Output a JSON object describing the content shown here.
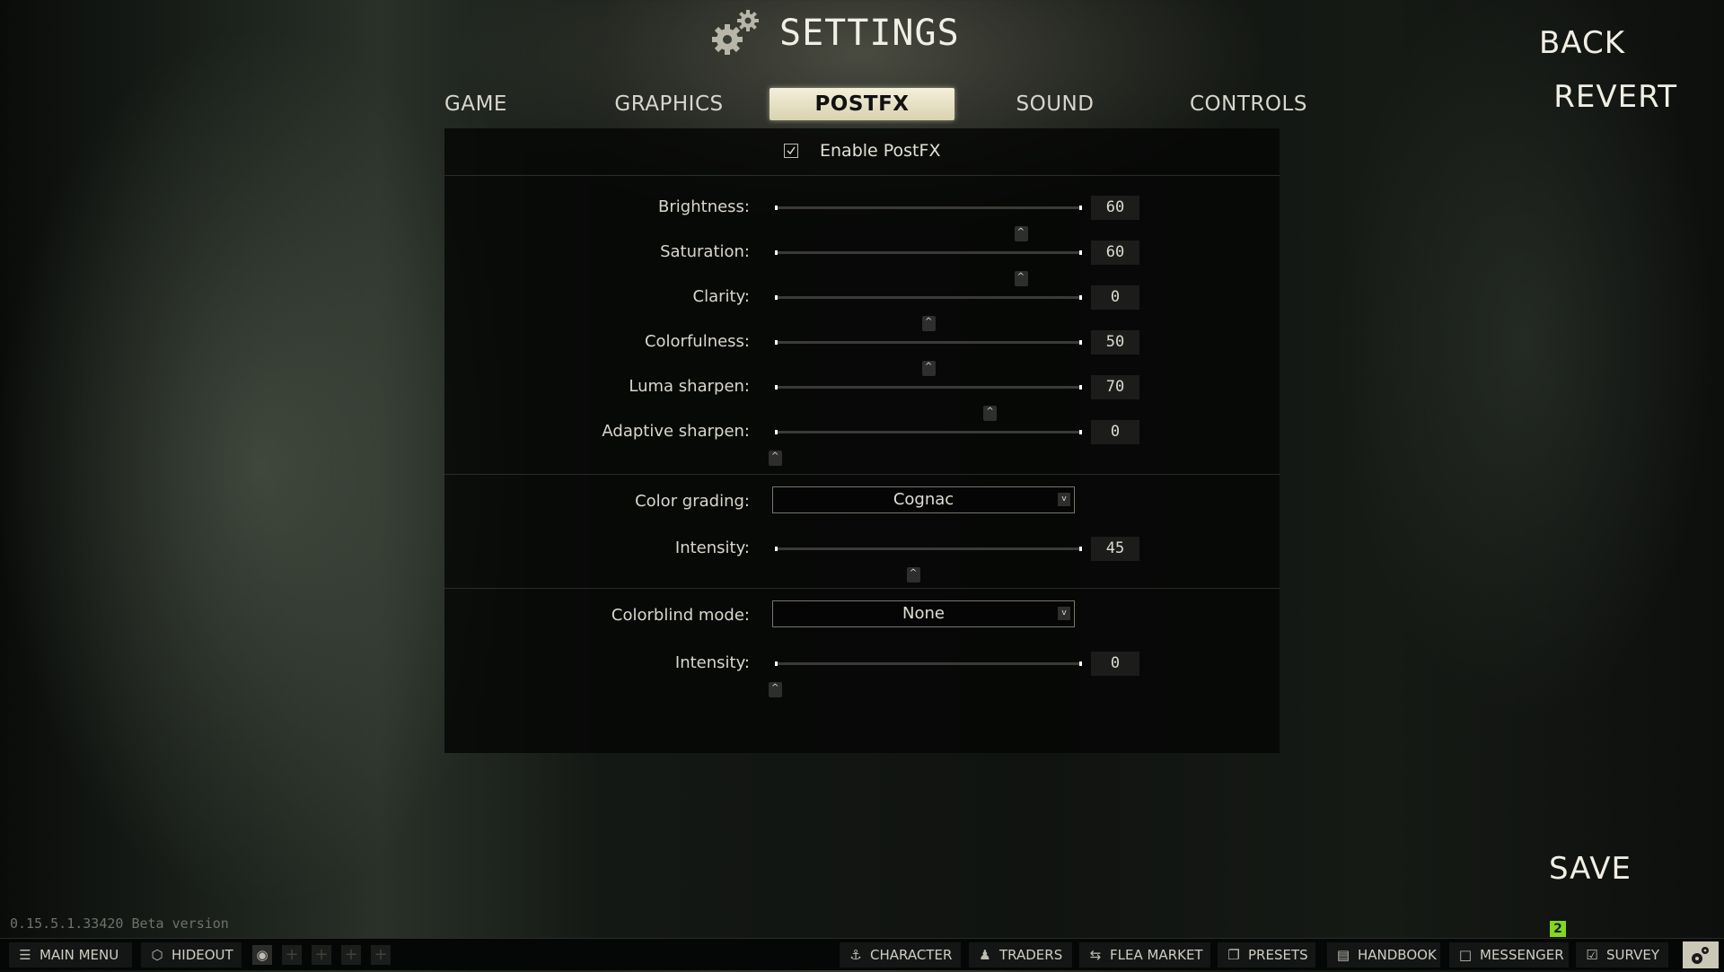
{
  "header": {
    "title": "SETTINGS",
    "icon": "gears-icon"
  },
  "tabs": [
    {
      "label": "GAME",
      "active": false
    },
    {
      "label": "GRAPHICS",
      "active": false
    },
    {
      "label": "POSTFX",
      "active": true
    },
    {
      "label": "SOUND",
      "active": false
    },
    {
      "label": "CONTROLS",
      "active": false
    }
  ],
  "side_actions": {
    "back": "BACK",
    "revert": "REVERT",
    "save": "SAVE"
  },
  "postfx": {
    "enable": {
      "label": "Enable PostFX",
      "checked": true
    },
    "sliders": [
      {
        "label": "Brightness:",
        "value": "60",
        "position_pct": 80
      },
      {
        "label": "Saturation:",
        "value": "60",
        "position_pct": 80
      },
      {
        "label": "Clarity:",
        "value": "0",
        "position_pct": 50
      },
      {
        "label": "Colorfulness:",
        "value": "50",
        "position_pct": 50
      },
      {
        "label": "Luma sharpen:",
        "value": "70",
        "position_pct": 70
      },
      {
        "label": "Adaptive sharpen:",
        "value": "0",
        "position_pct": 0
      }
    ],
    "color_grading": {
      "label": "Color grading:",
      "selected": "Cognac",
      "intensity": {
        "label": "Intensity:",
        "value": "45",
        "position_pct": 45
      }
    },
    "colorblind": {
      "label": "Colorblind mode:",
      "selected": "None",
      "intensity": {
        "label": "Intensity:",
        "value": "0",
        "position_pct": 0
      }
    }
  },
  "footer": {
    "version": "0.15.5.1.33420 Beta version",
    "left_buttons": [
      {
        "label": "MAIN MENU",
        "icon": "menu-icon"
      },
      {
        "label": "HIDEOUT",
        "icon": "hideout-icon"
      }
    ],
    "right_buttons": [
      {
        "label": "CHARACTER",
        "icon": "character-icon"
      },
      {
        "label": "TRADERS",
        "icon": "traders-icon"
      },
      {
        "label": "FLEA MARKET",
        "icon": "flea-market-icon"
      },
      {
        "label": "PRESETS",
        "icon": "presets-icon"
      },
      {
        "label": "HANDBOOK",
        "icon": "handbook-icon"
      },
      {
        "label": "MESSENGER",
        "icon": "messenger-icon"
      },
      {
        "label": "SURVEY",
        "icon": "survey-icon"
      }
    ],
    "messenger_badge": "2",
    "slot_plus": "+",
    "colors": {
      "badge": "#86d51e",
      "active_tab": "#efe9cf"
    }
  }
}
